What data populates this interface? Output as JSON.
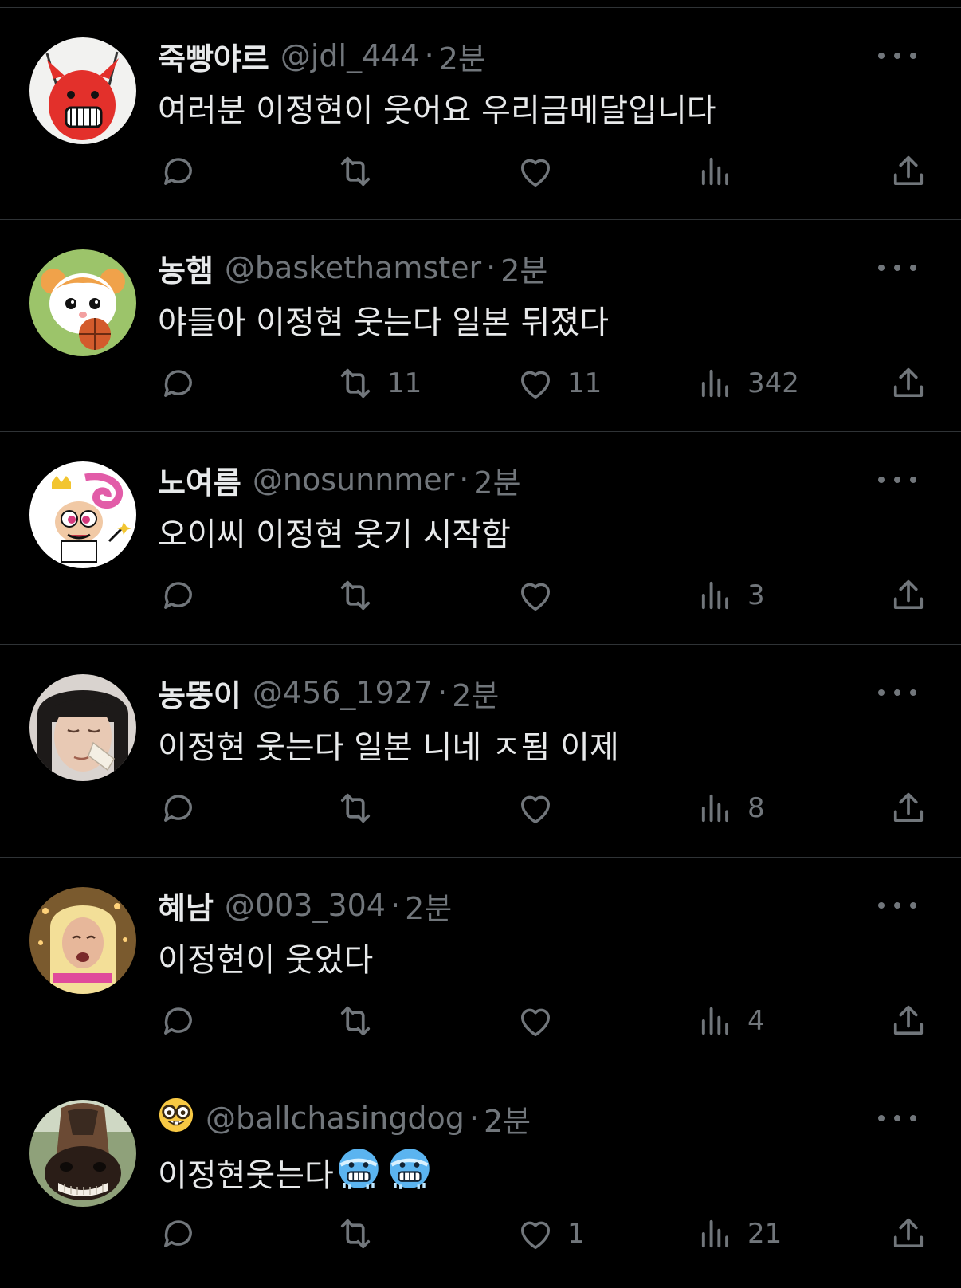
{
  "tweets": [
    {
      "name": "죽빵야르",
      "handle": "@jdl_444",
      "dot": "·",
      "time": "2분",
      "text": "여러분 이정현이 웃어요 우리금메달입니다",
      "retweets": "",
      "likes": "",
      "views": "",
      "avatar_icon": "red-monster-avatar"
    },
    {
      "name": "농햄",
      "handle": "@baskethamster",
      "dot": "·",
      "time": "2분",
      "text": "야들아 이정현 웃는다 일본 뒤졌다",
      "retweets": "11",
      "likes": "11",
      "views": "342",
      "avatar_icon": "hamster-avatar"
    },
    {
      "name": "노여름",
      "handle": "@nosunnmer",
      "dot": "·",
      "time": "2분",
      "text": "오이씨 이정현 웃기 시작함",
      "retweets": "",
      "likes": "",
      "views": "3",
      "avatar_icon": "cartoon-fairy-avatar"
    },
    {
      "name": "농뚱이",
      "handle": "@456_1927",
      "dot": "·",
      "time": "2분",
      "text": "이정현 웃는다 일본 니네 ㅈ됨 이제",
      "retweets": "",
      "likes": "",
      "views": "8",
      "avatar_icon": "crying-girl-avatar"
    },
    {
      "name": "혜남",
      "handle": "@003_304",
      "dot": "·",
      "time": "2분",
      "text": "이정현이 웃었다",
      "retweets": "",
      "likes": "",
      "views": "4",
      "avatar_icon": "blonde-wig-avatar"
    },
    {
      "name": "",
      "name_emoji": "nerd-face-emoji",
      "handle": "@ballchasingdog",
      "dot": "·",
      "time": "2분",
      "text": "이정현웃는다",
      "text_emoji": "cold-face-emoji ×2",
      "retweets": "",
      "likes": "1",
      "views": "21",
      "avatar_icon": "horse-avatar"
    }
  ],
  "colors": {
    "background": "#000000",
    "text": "#e7e9ea",
    "muted": "#71767b",
    "divider": "#2f3336"
  }
}
